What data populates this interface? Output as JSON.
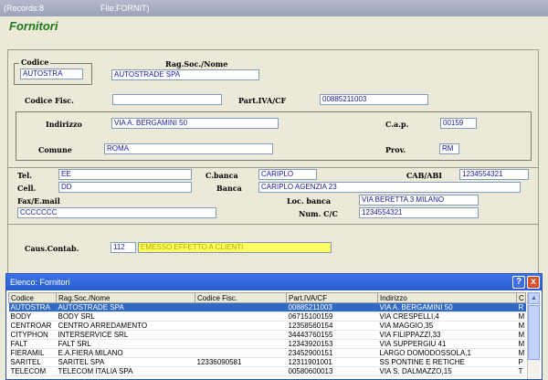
{
  "titlebar": {
    "records": "(Records:8",
    "file": "File:FORNIT)"
  },
  "form": {
    "heading": "Fornitori",
    "labels": {
      "codice": "Codice",
      "ragsoc": "Rag.Soc./Nome",
      "codfisc": "Codice Fisc.",
      "partiva": "Part.IVA/CF",
      "indirizzo": "Indirizzo",
      "cap": "C.a.p.",
      "comune": "Comune",
      "prov": "Prov.",
      "tel": "Tel.",
      "cbanca": "C.banca",
      "cababi": "CAB/ABI",
      "cell": "Cell.",
      "banca": "Banca",
      "faxemail": "Fax/E.mail",
      "locbanca": "Loc. banca",
      "numcc": "Num. C/C",
      "causcontab": "Caus.Contab."
    },
    "values": {
      "codice": "AUTOSTRA",
      "ragsoc": "AUTOSTRADE SPA",
      "codfisc": "",
      "partiva": "00885211003",
      "indirizzo": "VIA A. BERGAMINI 50",
      "cap": "00159",
      "comune": "ROMA",
      "prov": "RM",
      "tel": "EE",
      "cbanca": "CARIPLO",
      "cababi": "1234554321",
      "cell": "DD",
      "banca": "CARIPLO AGENZIA 23",
      "faxemail": "CCCCCCC",
      "locbanca": "VIA BERETTA 3  MILANO",
      "numcc": "1234554321",
      "causcode": "112",
      "causdesc": "EMESSO EFFETTO A CLIENTI"
    }
  },
  "list": {
    "title": "Elenco: Fornitori",
    "help_icon": "?",
    "close_icon": "x",
    "columns": [
      "Codice",
      "Rag.Soc./Nome",
      "Codice Fisc.",
      "Part.IVA/CF",
      "Indirizzo",
      "C"
    ],
    "rows": [
      [
        "AUTOSTRA",
        "AUTOSTRADE SPA",
        "",
        "00885211003",
        "VIA A. BERGAMINI 50",
        "R"
      ],
      [
        "BODY",
        "BODY SRL",
        "",
        "06715100159",
        "VIA CRESPELLI,4",
        "M"
      ],
      [
        "CENTROAR",
        "CENTRO ARREDAMENTO",
        "",
        "12358560154",
        "VIA MAGGIO,35",
        "M"
      ],
      [
        "CITYPHON",
        "INTERSERVICE SRL",
        "",
        "34443760155",
        "VIA FILIPPAZZI,33",
        "M"
      ],
      [
        "FALT",
        "FALT SRL",
        "",
        "12343920153",
        "VIA SUPPERGIU 41",
        "M"
      ],
      [
        "FIERAMIL",
        "E.A.FIERA MILANO",
        "",
        "23452900151",
        "LARGO DOMODOSSOLA,1",
        "M"
      ],
      [
        "SARITEL",
        "SARITEL SPA",
        "12336090581",
        "12311901001",
        "SS PONTINE E RETICHE",
        "P"
      ],
      [
        "TELECOM",
        "TELECOM ITALIA SPA",
        "",
        "00580600013",
        "VIA S. DALMAZZO,15",
        "T"
      ]
    ]
  }
}
